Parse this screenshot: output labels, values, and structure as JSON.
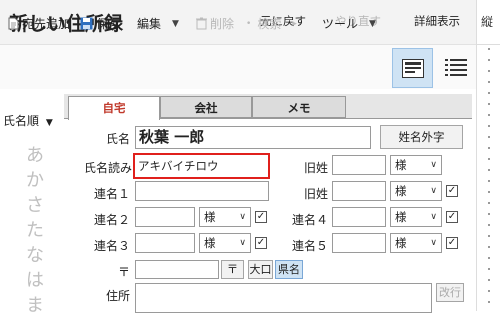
{
  "app": {
    "title": "新しい住所録"
  },
  "titlebar": {
    "undo": "元に戻す",
    "redo": "やり直す",
    "detail": "詳細表示"
  },
  "right_edge": {
    "label": "縦"
  },
  "toolbar": {
    "add": "宛先追加",
    "save": "保存",
    "edit": "編集",
    "delete": "削除",
    "search": "検索",
    "tools": "ツール"
  },
  "sidebar": {
    "sort": "氏名順",
    "kana": [
      "あ",
      "か",
      "さ",
      "た",
      "な",
      "は",
      "ま"
    ]
  },
  "tabs": [
    "自宅",
    "会社",
    "メモ"
  ],
  "form": {
    "name_label": "氏名",
    "name_value": "秋葉 一郎",
    "name_outside_button": "姓名外字",
    "reading_label": "氏名読み",
    "reading_value": "アキバイチロウ",
    "old_surname_label": "旧姓",
    "old_surname_label2": "旧姓",
    "honorific": "様",
    "co1_label": "連名１",
    "co2_label": "連名２",
    "co3_label": "連名３",
    "co4_label": "連名４",
    "co5_label": "連名５",
    "zip_label": "〒",
    "zip_button": "〒",
    "okuchi_button": "大口",
    "ken_button": "県名",
    "address_label": "住所",
    "newline_button": "改行"
  },
  "colors": {
    "accent": "#c0392b",
    "highlight_border": "#e0201c",
    "selected_view": "#cfe3f4"
  }
}
